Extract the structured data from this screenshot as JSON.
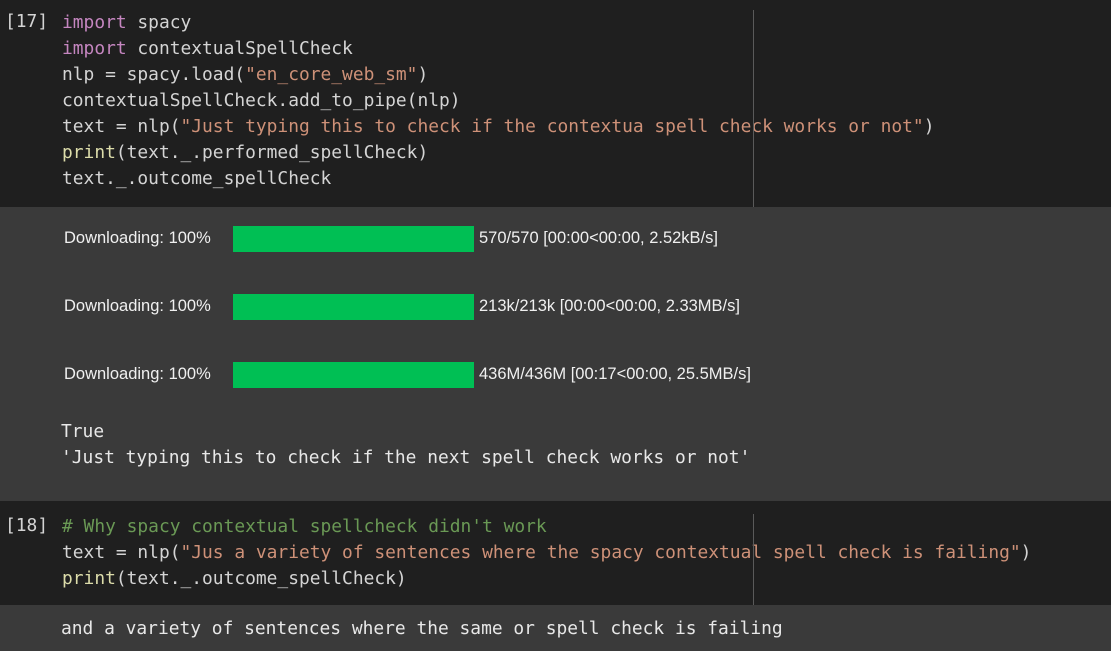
{
  "cells": [
    {
      "prompt": "[17]",
      "code": [
        [
          {
            "t": "import",
            "c": "kw"
          },
          {
            "t": " spacy",
            "c": ""
          }
        ],
        [
          {
            "t": "import",
            "c": "kw"
          },
          {
            "t": " contextualSpellCheck",
            "c": ""
          }
        ],
        [
          {
            "t": "nlp = spacy.load(",
            "c": ""
          },
          {
            "t": "\"en_core_web_sm\"",
            "c": "str"
          },
          {
            "t": ")",
            "c": ""
          }
        ],
        [
          {
            "t": "contextualSpellCheck.add_to_pipe(nlp)",
            "c": ""
          }
        ],
        [
          {
            "t": "text = nlp(",
            "c": ""
          },
          {
            "t": "\"Just typing this to check if the contextua spell check works or not\"",
            "c": "str"
          },
          {
            "t": ")",
            "c": ""
          }
        ],
        [
          {
            "t": "print",
            "c": "fn"
          },
          {
            "t": "(text._.performed_spellCheck)",
            "c": ""
          }
        ],
        [
          {
            "t": "text._.outcome_spellCheck",
            "c": ""
          }
        ]
      ],
      "downloads": [
        {
          "label": "Downloading: 100%",
          "progress": 1.0,
          "stats": "570/570 [00:00<00:00, 2.52kB/s]"
        },
        {
          "label": "Downloading: 100%",
          "progress": 1.0,
          "stats": "213k/213k [00:00<00:00, 2.33MB/s]"
        },
        {
          "label": "Downloading: 100%",
          "progress": 1.0,
          "stats": "436M/436M [00:17<00:00, 25.5MB/s]"
        }
      ],
      "output_lines": [
        "True",
        "'Just typing this to check if the next spell check works or not'"
      ]
    },
    {
      "prompt": "[18]",
      "code": [
        [
          {
            "t": "# Why spacy contextual spellcheck didn't work",
            "c": "com"
          }
        ],
        [
          {
            "t": "text = nlp(",
            "c": ""
          },
          {
            "t": "\"Jus a variety of sentences where the spacy contextual spell check is failing\"",
            "c": "str"
          },
          {
            "t": ")",
            "c": ""
          }
        ],
        [
          {
            "t": "print",
            "c": "fn"
          },
          {
            "t": "(text._.outcome_spellCheck)",
            "c": ""
          }
        ]
      ],
      "output_lines": [
        "and a variety of sentences where the same or spell check is failing"
      ]
    }
  ],
  "colors": {
    "progress_fill": "#00bf54",
    "input_bg": "#1f1f1f",
    "output_bg": "#3a3a3a",
    "keyword": "#c586c0",
    "function": "#dcdcaa",
    "string": "#ce9178",
    "comment": "#6a9955"
  }
}
